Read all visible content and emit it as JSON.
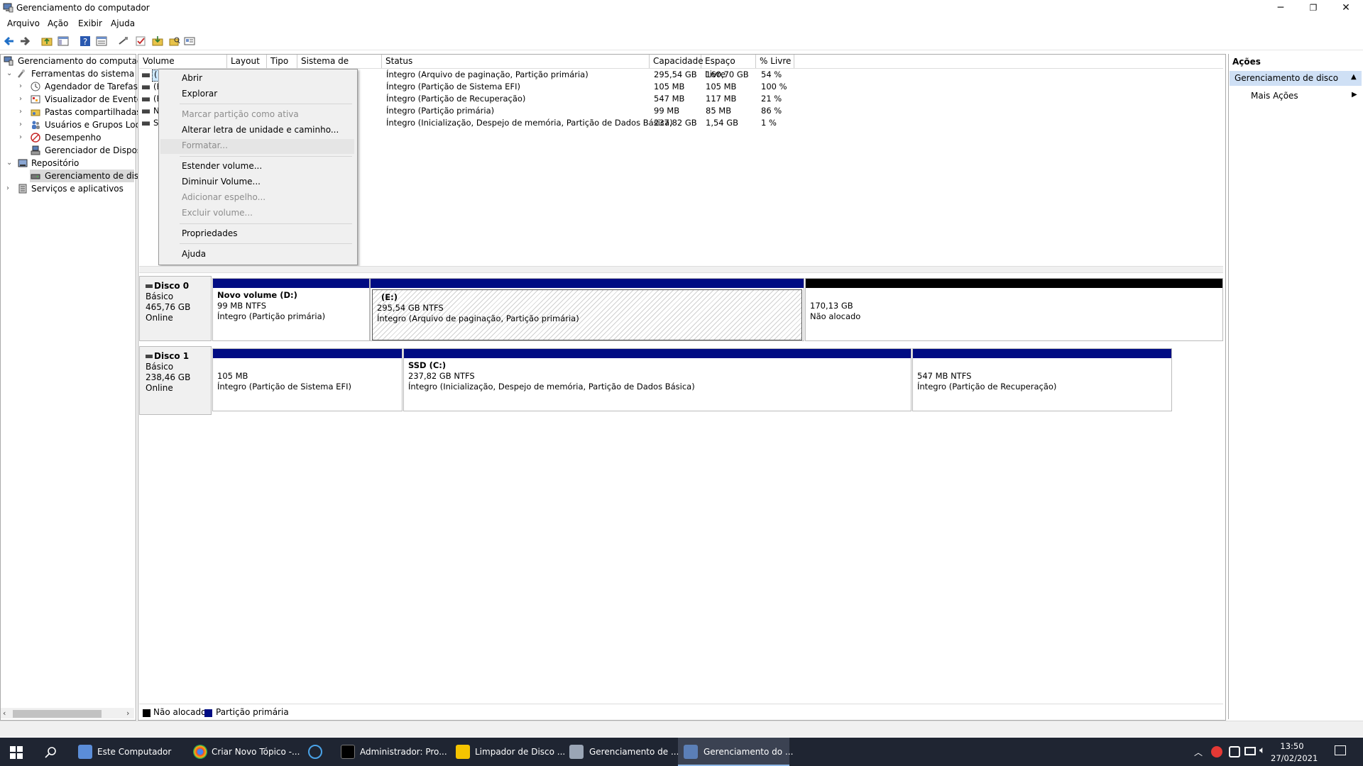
{
  "window": {
    "title": "Gerenciamento do computador",
    "controls": {
      "minimize": "─",
      "restore": "❐",
      "close": "✕"
    }
  },
  "menu": [
    "Arquivo",
    "Ação",
    "Exibir",
    "Ajuda"
  ],
  "tree": {
    "root": "Gerenciamento do computado",
    "items": [
      {
        "label": "Ferramentas do sistema"
      },
      {
        "label": "Agendador de Tarefas"
      },
      {
        "label": "Visualizador de Eventos"
      },
      {
        "label": "Pastas compartilhadas"
      },
      {
        "label": "Usuários e Grupos Loca"
      },
      {
        "label": "Desempenho"
      },
      {
        "label": "Gerenciador de Disposit"
      },
      {
        "label": "Repositório"
      },
      {
        "label": "Gerenciamento de disco"
      },
      {
        "label": "Serviços e aplicativos"
      }
    ]
  },
  "table": {
    "columns": [
      "Volume",
      "Layout",
      "Tipo",
      "Sistema de Arquivos",
      "Status",
      "Capacidade",
      "Espaço Livre",
      "% Livre"
    ],
    "rows": [
      {
        "volume": "(",
        "status": "Íntegro (Arquivo de paginação, Partição primária)",
        "capacity": "295,54 GB",
        "free": "160,70 GB",
        "pct": "54 %"
      },
      {
        "volume": "(E",
        "status": "Íntegro (Partição de Sistema EFI)",
        "capacity": "105 MB",
        "free": "105 MB",
        "pct": "100 %"
      },
      {
        "volume": "(E",
        "status": "Íntegro (Partição de Recuperação)",
        "capacity": "547 MB",
        "free": "117 MB",
        "pct": "21 %"
      },
      {
        "volume": "N",
        "status": "Íntegro (Partição primária)",
        "capacity": "99 MB",
        "free": "85 MB",
        "pct": "86 %"
      },
      {
        "volume": "S",
        "status": "Íntegro (Inicialização, Despejo de memória, Partição de Dados Básica)",
        "capacity": "237,82 GB",
        "free": "1,54 GB",
        "pct": "1 %"
      }
    ]
  },
  "context_menu": {
    "items": [
      {
        "label": "Abrir",
        "enabled": true
      },
      {
        "label": "Explorar",
        "enabled": true
      },
      {
        "label": "Marcar partição como ativa",
        "enabled": false
      },
      {
        "label": "Alterar letra de unidade e caminho...",
        "enabled": true
      },
      {
        "label": "Formatar...",
        "enabled": false
      },
      {
        "label": "Estender volume...",
        "enabled": true
      },
      {
        "label": "Diminuir Volume...",
        "enabled": true
      },
      {
        "label": "Adicionar espelho...",
        "enabled": false
      },
      {
        "label": "Excluir volume...",
        "enabled": false
      },
      {
        "label": "Propriedades",
        "enabled": true
      },
      {
        "label": "Ajuda",
        "enabled": true
      }
    ]
  },
  "disks": [
    {
      "name": "Disco 0",
      "type": "Básico",
      "size": "465,76 GB",
      "state": "Online",
      "partitions": [
        {
          "name": "Novo volume  (D:)",
          "size": "99 MB NTFS",
          "status": "Íntegro (Partição primária)"
        },
        {
          "name": "(E:)",
          "size": "295,54 GB NTFS",
          "status": "Íntegro (Arquivo de paginação, Partição primária)"
        },
        {
          "name": "",
          "size": "170,13 GB",
          "status": "Não alocado"
        }
      ]
    },
    {
      "name": "Disco 1",
      "type": "Básico",
      "size": "238,46 GB",
      "state": "Online",
      "partitions": [
        {
          "name": "",
          "size": "105 MB",
          "status": "Íntegro (Partição de Sistema EFI)"
        },
        {
          "name": "SSD  (C:)",
          "size": "237,82 GB NTFS",
          "status": "Íntegro (Inicialização, Despejo de memória, Partição de Dados Básica)"
        },
        {
          "name": "",
          "size": "547 MB NTFS",
          "status": "Íntegro (Partição de Recuperação)"
        }
      ]
    }
  ],
  "legend": [
    {
      "label": "Não alocado",
      "color": "#000000"
    },
    {
      "label": "Partição primária",
      "color": "#000c83"
    }
  ],
  "actions": {
    "header": "Ações",
    "section": "Gerenciamento de disco",
    "more": "Mais Ações"
  },
  "taskbar": {
    "items": [
      {
        "label": "Este Computador"
      },
      {
        "label": "Criar Novo Tópico -..."
      },
      {
        "label": "Administrador: Pro..."
      },
      {
        "label": "Limpador de Disco ..."
      },
      {
        "label": "Gerenciamento de ..."
      },
      {
        "label": "Gerenciamento do ..."
      }
    ],
    "time": "13:50",
    "date": "27/02/2021"
  },
  "colors": {
    "primary_partition": "#000c83",
    "unallocated": "#000000",
    "taskbar": "#1f2532",
    "selection": "#cce8ff"
  }
}
